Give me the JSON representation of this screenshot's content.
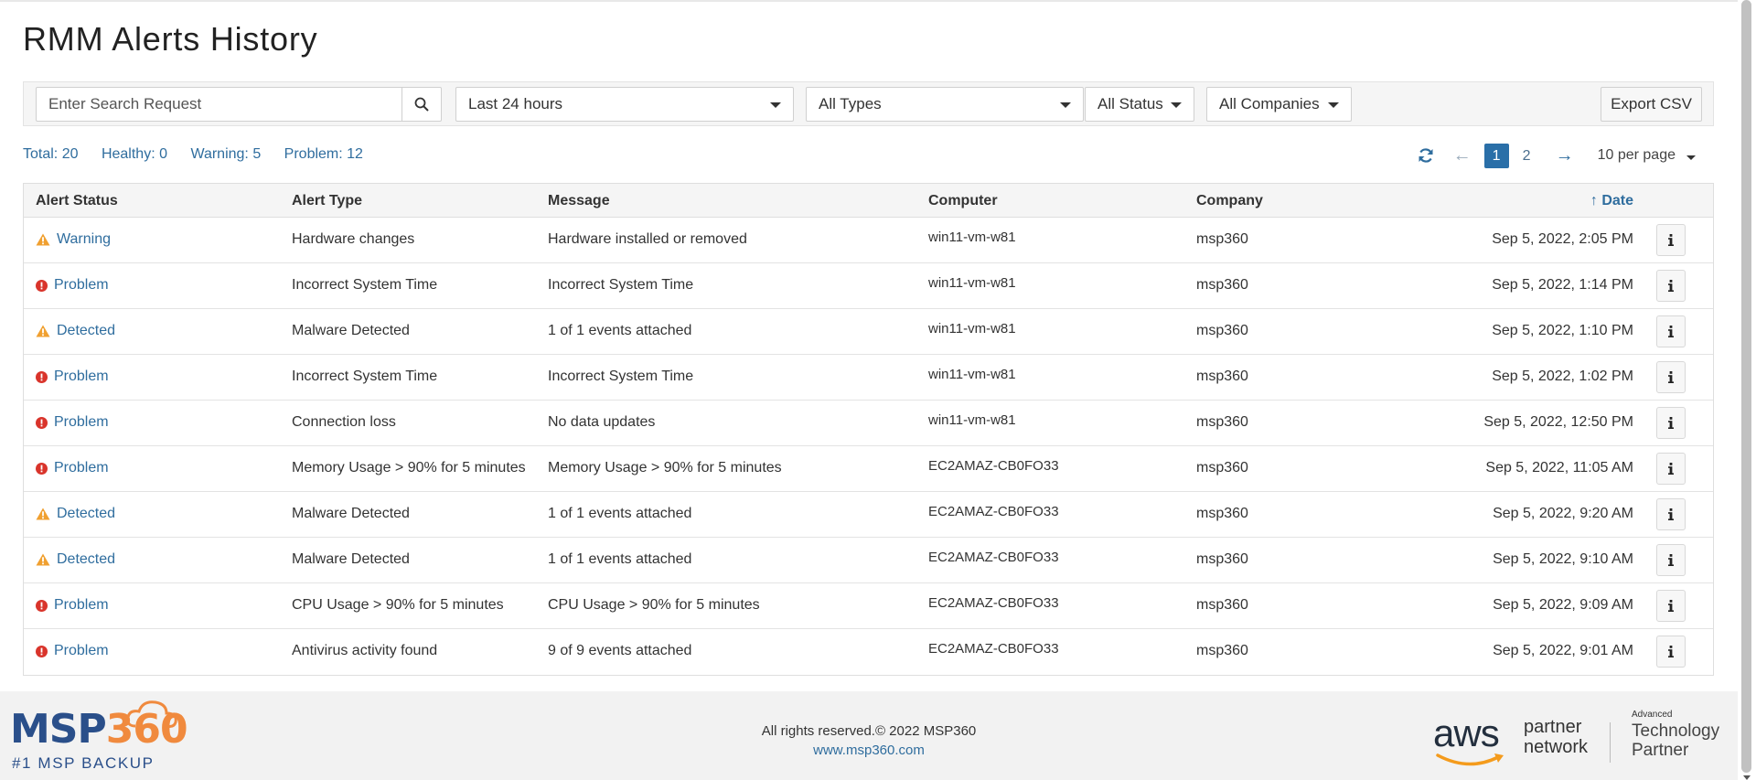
{
  "page": {
    "title": "RMM Alerts History"
  },
  "filters": {
    "search_placeholder": "Enter Search Request",
    "time_range": "Last 24 hours",
    "type": "All Types",
    "status": "All Status",
    "company": "All Companies",
    "export_label": "Export CSV"
  },
  "summary": {
    "total": "Total: 20",
    "healthy": "Healthy: 0",
    "warning": "Warning: 5",
    "problem": "Problem: 12"
  },
  "pagination": {
    "current_page": "1",
    "next_page": "2",
    "prev_arrow": "←",
    "next_arrow": "→",
    "per_page": "10 per page"
  },
  "table": {
    "columns": {
      "status": "Alert Status",
      "type": "Alert Type",
      "message": "Message",
      "computer": "Computer",
      "company": "Company",
      "date": "↑ Date"
    },
    "rows": [
      {
        "status": "Warning",
        "level": "warning",
        "type": "Hardware changes",
        "message": "Hardware installed or removed",
        "computer": "win11-vm-w81",
        "company": "msp360",
        "date": "Sep 5, 2022, 2:05 PM"
      },
      {
        "status": "Problem",
        "level": "problem",
        "type": "Incorrect System Time",
        "message": "Incorrect System Time",
        "computer": "win11-vm-w81",
        "company": "msp360",
        "date": "Sep 5, 2022, 1:14 PM"
      },
      {
        "status": "Detected",
        "level": "warning",
        "type": "Malware Detected",
        "message": "1 of 1 events attached",
        "computer": "win11-vm-w81",
        "company": "msp360",
        "date": "Sep 5, 2022, 1:10 PM"
      },
      {
        "status": "Problem",
        "level": "problem",
        "type": "Incorrect System Time",
        "message": "Incorrect System Time",
        "computer": "win11-vm-w81",
        "company": "msp360",
        "date": "Sep 5, 2022, 1:02 PM"
      },
      {
        "status": "Problem",
        "level": "problem",
        "type": "Connection loss",
        "message": "No data updates",
        "computer": "win11-vm-w81",
        "company": "msp360",
        "date": "Sep 5, 2022, 12:50 PM"
      },
      {
        "status": "Problem",
        "level": "problem",
        "type": "Memory Usage > 90% for 5 minutes",
        "message": "Memory Usage > 90% for 5 minutes",
        "computer": "EC2AMAZ-CB0FO33",
        "company": "msp360",
        "date": "Sep 5, 2022, 11:05 AM"
      },
      {
        "status": "Detected",
        "level": "warning",
        "type": "Malware Detected",
        "message": "1 of 1 events attached",
        "computer": "EC2AMAZ-CB0FO33",
        "company": "msp360",
        "date": "Sep 5, 2022, 9:20 AM"
      },
      {
        "status": "Detected",
        "level": "warning",
        "type": "Malware Detected",
        "message": "1 of 1 events attached",
        "computer": "EC2AMAZ-CB0FO33",
        "company": "msp360",
        "date": "Sep 5, 2022, 9:10 AM"
      },
      {
        "status": "Problem",
        "level": "problem",
        "type": "CPU Usage > 90% for 5 minutes",
        "message": "CPU Usage > 90% for 5 minutes",
        "computer": "EC2AMAZ-CB0FO33",
        "company": "msp360",
        "date": "Sep 5, 2022, 9:09 AM"
      },
      {
        "status": "Problem",
        "level": "problem",
        "type": "Antivirus activity found",
        "message": "9 of 9 events attached",
        "computer": "EC2AMAZ-CB0FO33",
        "company": "msp360",
        "date": "Sep 5, 2022, 9:01 AM"
      }
    ]
  },
  "footer": {
    "logo_msp": "MSP",
    "logo_360": "360",
    "logo_tagline": "#1 MSP BACKUP",
    "copyright": "All rights reserved.© 2022 MSP360",
    "website": "www.msp360.com",
    "aws_text": "aws",
    "partner_line1": "partner",
    "partner_line2": "network",
    "tech_small": "Advanced",
    "tech_line1": "Technology",
    "tech_line2": "Partner"
  },
  "colors": {
    "link": "#2f6d9e",
    "warning": "#f0a030",
    "problem": "#d9342b",
    "active_page": "#2a6fa8",
    "brand_blue": "#2a4f8a",
    "brand_orange": "#f08a3e"
  },
  "icons": {
    "search": "search-icon",
    "refresh": "refresh-icon",
    "warning": "warning-triangle-icon",
    "problem": "exclamation-circle-icon",
    "info": "info-icon"
  }
}
